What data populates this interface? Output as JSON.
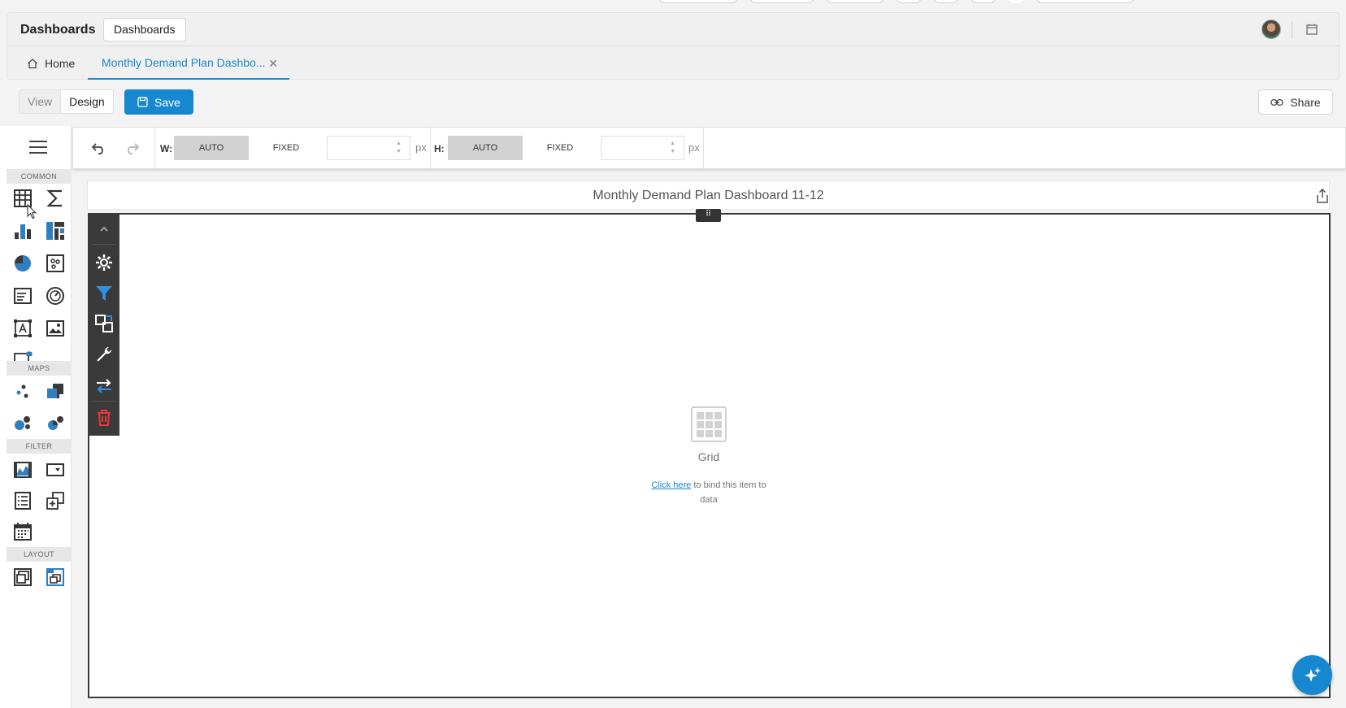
{
  "header": {
    "app_title": "Dashboards",
    "breadcrumb_chip": "Dashboards"
  },
  "tabs": {
    "home_label": "Home",
    "active_tab_label": "Monthly Demand Plan Dashbo..."
  },
  "toolbar": {
    "view_label": "View",
    "design_label": "Design",
    "save_label": "Save",
    "share_label": "Share"
  },
  "toolbox": {
    "sections": {
      "common": "COMMON",
      "maps": "MAPS",
      "filter": "FILTER",
      "layout": "LAYOUT"
    }
  },
  "options": {
    "width_label": "W:",
    "height_label": "H:",
    "auto_label": "AUTO",
    "fixed_label": "FIXED",
    "unit": "px",
    "width_value": "",
    "height_value": ""
  },
  "dashboard": {
    "title": "Monthly Demand Plan Dashboard 11-12",
    "placeholder_label": "Grid",
    "bind_link": "Click here",
    "bind_hint": " to bind this item to data"
  },
  "colors": {
    "accent": "#1788d0",
    "danger": "#e53935",
    "menu_bg": "#3a3a3a"
  }
}
